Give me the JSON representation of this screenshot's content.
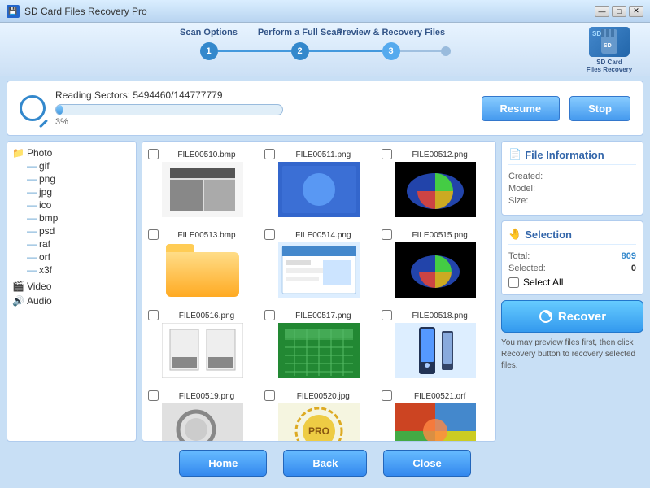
{
  "titlebar": {
    "title": "SD Card Files Recovery Pro",
    "icon": "💾",
    "btn_minimize": "—",
    "btn_maximize": "□",
    "btn_close": "✕"
  },
  "steps": [
    {
      "label": "Scan Options",
      "num": "1",
      "state": "done"
    },
    {
      "label": "Perform a Full Scan",
      "num": "2",
      "state": "done"
    },
    {
      "label": "Preview & Recovery Files",
      "num": "3",
      "state": "active"
    }
  ],
  "sdlogo": {
    "label": "SD Card\nFiles Recovery"
  },
  "progress": {
    "reading_text": "Reading Sectors: 5494460/144777779",
    "percent": "3%",
    "bar_width": "3",
    "resume_label": "Resume",
    "stop_label": "Stop"
  },
  "filetree": {
    "items": [
      {
        "label": "Photo",
        "level": "parent",
        "icon": "folder"
      },
      {
        "label": "gif",
        "level": "child",
        "icon": "file"
      },
      {
        "label": "png",
        "level": "child",
        "icon": "file"
      },
      {
        "label": "jpg",
        "level": "child",
        "icon": "file"
      },
      {
        "label": "ico",
        "level": "child",
        "icon": "file"
      },
      {
        "label": "bmp",
        "level": "child",
        "icon": "file"
      },
      {
        "label": "psd",
        "level": "child",
        "icon": "file"
      },
      {
        "label": "raf",
        "level": "child",
        "icon": "file"
      },
      {
        "label": "orf",
        "level": "child",
        "icon": "file"
      },
      {
        "label": "x3f",
        "level": "child",
        "icon": "file"
      },
      {
        "label": "Video",
        "level": "parent",
        "icon": "video"
      },
      {
        "label": "Audio",
        "level": "parent",
        "icon": "audio"
      }
    ]
  },
  "filegrid": {
    "files": [
      {
        "name": "FILE00510.bmp",
        "type": "bmp"
      },
      {
        "name": "FILE00511.png",
        "type": "png-blue"
      },
      {
        "name": "FILE00512.png",
        "type": "png-dark"
      },
      {
        "name": "FILE00513.bmp",
        "type": "folder"
      },
      {
        "name": "FILE00514.png",
        "type": "screenshot"
      },
      {
        "name": "FILE00515.png",
        "type": "pie"
      },
      {
        "name": "FILE00516.png",
        "type": "whitedoc"
      },
      {
        "name": "FILE00517.png",
        "type": "greencal"
      },
      {
        "name": "FILE00518.png",
        "type": "phone"
      },
      {
        "name": "FILE00519.png",
        "type": "magnify"
      },
      {
        "name": "FILE00520.jpg",
        "type": "stamp"
      },
      {
        "name": "FILE00521.orf",
        "type": "colorful"
      }
    ]
  },
  "fileinfo": {
    "title": "File Information",
    "created_label": "Created:",
    "created_value": "",
    "model_label": "Model:",
    "model_value": "",
    "size_label": "Size:",
    "size_value": ""
  },
  "selection": {
    "title": "Selection",
    "total_label": "Total:",
    "total_value": "809",
    "selected_label": "Selected:",
    "selected_value": "0",
    "select_all_label": "Select All"
  },
  "recover": {
    "label": "Recover",
    "hint": "You may preview files first, then click Recovery button to recovery selected files."
  },
  "bottombar": {
    "home_label": "Home",
    "back_label": "Back",
    "close_label": "Close"
  }
}
